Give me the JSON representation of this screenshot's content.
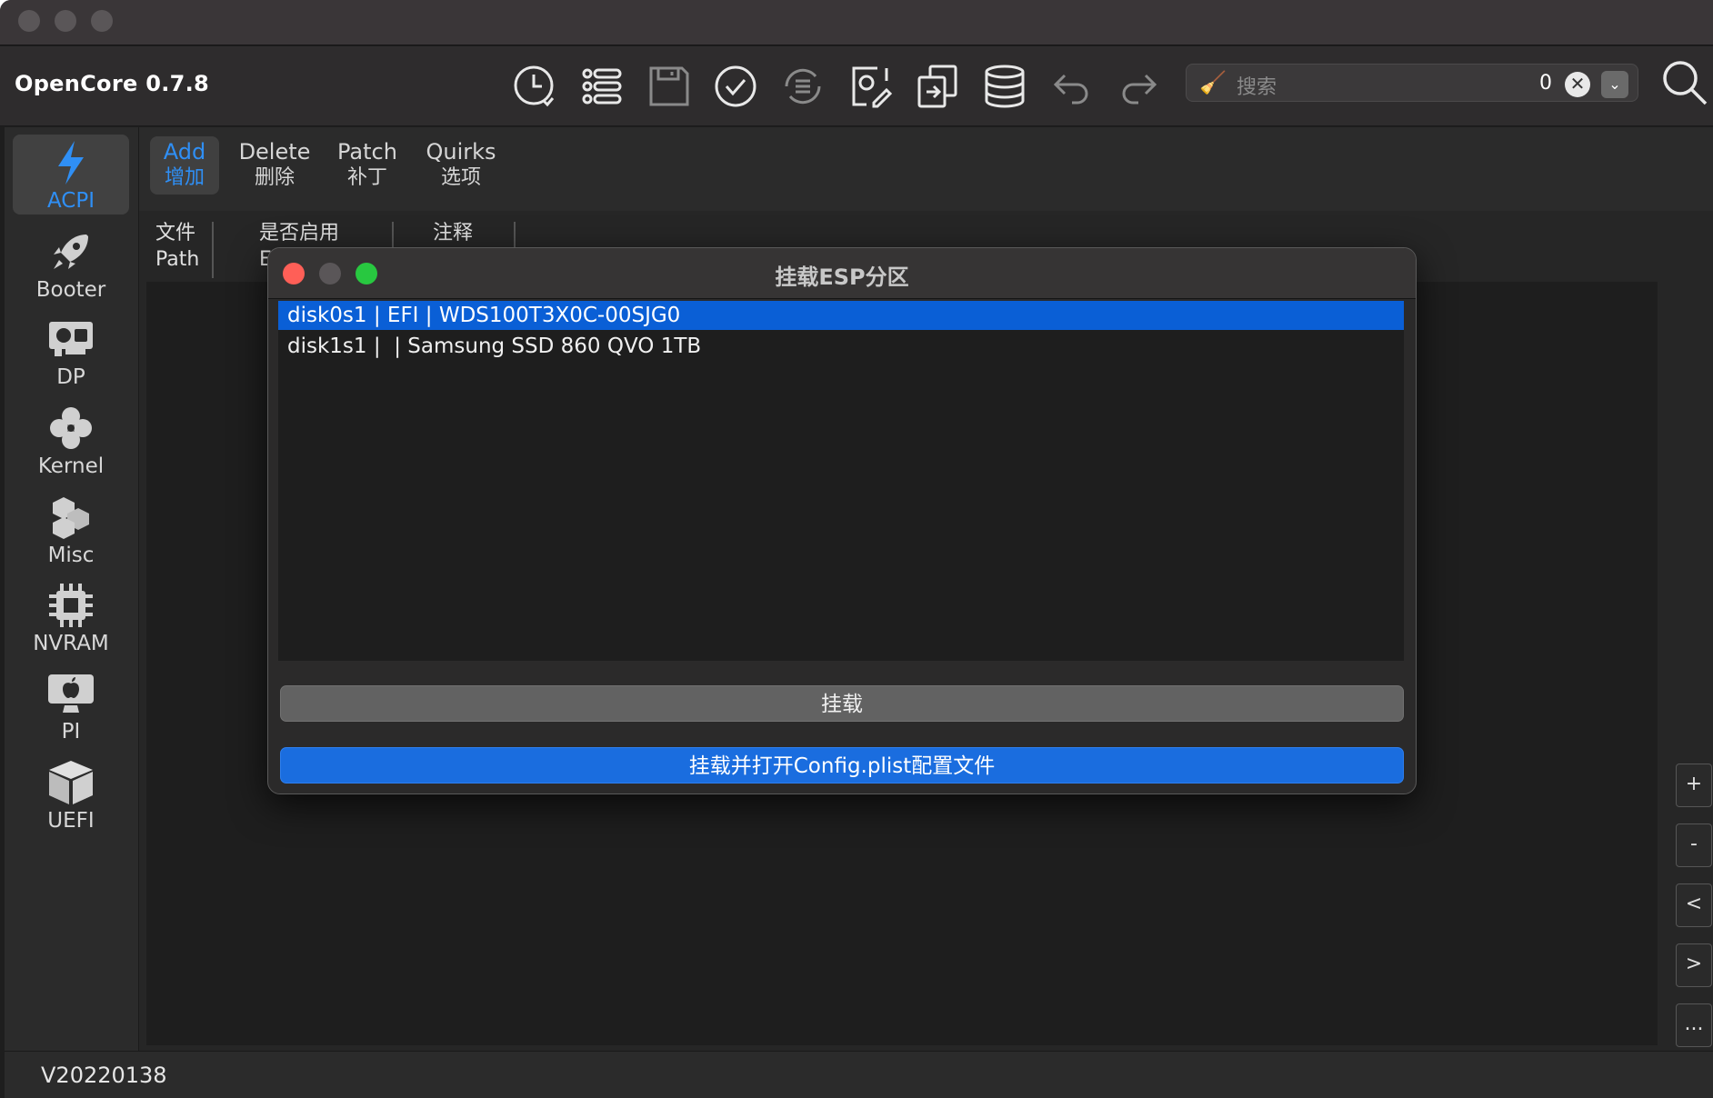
{
  "app": {
    "title": "OpenCore 0.7.8",
    "version": "V20220138"
  },
  "toolbar": {
    "icons": [
      "clock-icon",
      "list-icon",
      "save-icon",
      "check-icon",
      "list-refresh-icon",
      "signature-icon",
      "share-icon",
      "database-icon",
      "undo-icon",
      "redo-icon"
    ],
    "search": {
      "placeholder": "搜索",
      "count": "0",
      "clear_label": "✕",
      "dropdown_label": "⌄"
    }
  },
  "sidebar": {
    "items": [
      {
        "label": "ACPI",
        "icon": "lightning-icon",
        "active": true
      },
      {
        "label": "Booter",
        "icon": "rocket-icon"
      },
      {
        "label": "DP",
        "icon": "gpu-icon"
      },
      {
        "label": "Kernel",
        "icon": "kernel-icon"
      },
      {
        "label": "Misc",
        "icon": "cubes-icon"
      },
      {
        "label": "NVRAM",
        "icon": "chip-icon"
      },
      {
        "label": "PI",
        "icon": "apple-icon"
      },
      {
        "label": "UEFI",
        "icon": "box-icon"
      }
    ]
  },
  "tabs": [
    {
      "en": "Add",
      "zh": "增加",
      "active": true
    },
    {
      "en": "Delete",
      "zh": "删除"
    },
    {
      "en": "Patch",
      "zh": "补丁"
    },
    {
      "en": "Quirks",
      "zh": "选项"
    }
  ],
  "table": {
    "columns": [
      {
        "zh": "文件",
        "en": "Path"
      },
      {
        "zh": "是否启用",
        "en": "E"
      },
      {
        "zh": "注释",
        "en": ""
      }
    ]
  },
  "side_buttons": [
    "+",
    "-",
    "<",
    ">",
    "..."
  ],
  "dialog": {
    "title": "挂载ESP分区",
    "rows": [
      {
        "text": "disk0s1 | EFI | WDS100T3X0C-00SJG0",
        "selected": true
      },
      {
        "text": "disk1s1 |  | Samsung SSD 860 QVO 1TB",
        "selected": false
      }
    ],
    "mount_label": "挂载",
    "mount_open_label": "挂载并打开Config.plist配置文件"
  },
  "colors": {
    "accent": "#2f8ff5",
    "selection": "#0a5fd6",
    "primary_button": "#1a6ddf",
    "close": "#ff5f57",
    "zoom": "#28c840"
  }
}
